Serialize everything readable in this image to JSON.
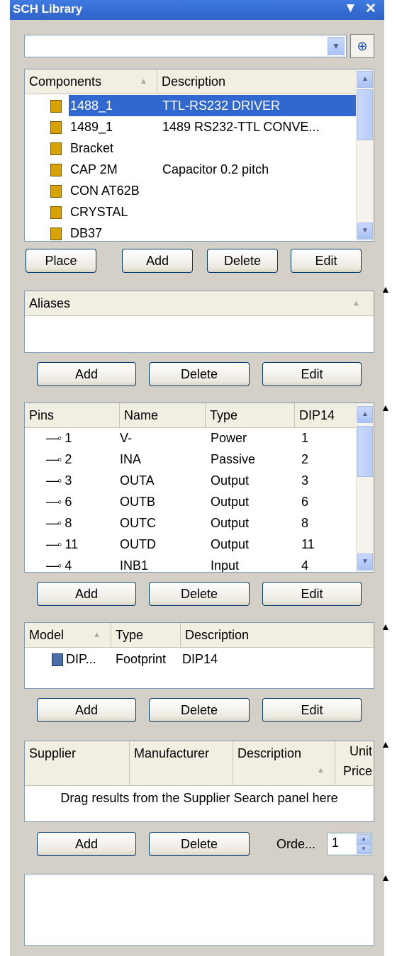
{
  "panel": {
    "title": "SCH Library",
    "menu_icon": "▼",
    "close_icon": "✕"
  },
  "search": {
    "value": "",
    "placeholder": ""
  },
  "components": {
    "headers": [
      "Components",
      "Description"
    ],
    "rows": [
      {
        "name": "1488_1",
        "desc": "TTL-RS232 DRIVER",
        "selected": true
      },
      {
        "name": "1489_1",
        "desc": "1489 RS232-TTL CONVE...",
        "selected": false
      },
      {
        "name": "Bracket",
        "desc": "",
        "selected": false
      },
      {
        "name": "CAP 2M",
        "desc": "Capacitor 0.2 pitch",
        "selected": false
      },
      {
        "name": "CON AT62B",
        "desc": "",
        "selected": false
      },
      {
        "name": "CRYSTAL",
        "desc": "",
        "selected": false
      },
      {
        "name": "DB37",
        "desc": "",
        "selected": false
      }
    ],
    "buttons": {
      "place": "Place",
      "add": "Add",
      "delete": "Delete",
      "edit": "Edit"
    }
  },
  "aliases": {
    "header": "Aliases",
    "buttons": {
      "add": "Add",
      "delete": "Delete",
      "edit": "Edit"
    }
  },
  "pins": {
    "headers": [
      "Pins",
      "Name",
      "Type",
      "DIP14"
    ],
    "rows": [
      {
        "pin": "1",
        "name": "V-",
        "type": "Power",
        "dip": "1"
      },
      {
        "pin": "2",
        "name": "INA",
        "type": "Passive",
        "dip": "2"
      },
      {
        "pin": "3",
        "name": "OUTA",
        "type": "Output",
        "dip": "3"
      },
      {
        "pin": "6",
        "name": "OUTB",
        "type": "Output",
        "dip": "6"
      },
      {
        "pin": "8",
        "name": "OUTC",
        "type": "Output",
        "dip": "8"
      },
      {
        "pin": "11",
        "name": "OUTD",
        "type": "Output",
        "dip": "11"
      },
      {
        "pin": "4",
        "name": "INB1",
        "type": "Input",
        "dip": "4"
      }
    ],
    "buttons": {
      "add": "Add",
      "delete": "Delete",
      "edit": "Edit"
    }
  },
  "models": {
    "headers": [
      "Model",
      "Type",
      "Description"
    ],
    "rows": [
      {
        "model": "DIP...",
        "type": "Footprint",
        "desc": "DIP14"
      }
    ],
    "buttons": {
      "add": "Add",
      "delete": "Delete",
      "edit": "Edit"
    }
  },
  "suppliers": {
    "headers": [
      "Supplier",
      "Manufacturer",
      "Description",
      "Unit",
      "Price"
    ],
    "empty_message": "Drag results from the Supplier Search panel here",
    "buttons": {
      "add": "Add",
      "delete": "Delete"
    },
    "order_label": "Orde...",
    "order_value": "1"
  },
  "colors": {
    "title_bar": "#2f62c8",
    "selection": "#3168d0",
    "panel_bg": "#d4d0c8"
  }
}
